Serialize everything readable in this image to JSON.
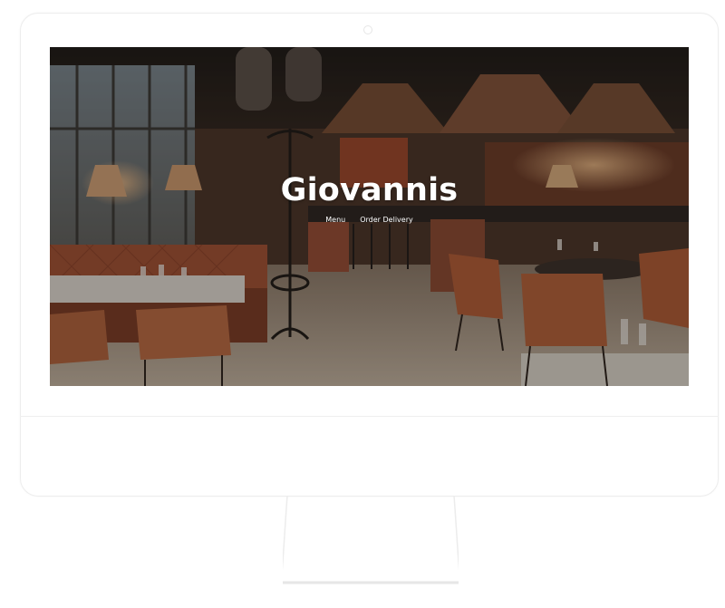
{
  "site": {
    "title": "Giovannis"
  },
  "nav": {
    "items": [
      {
        "label": "Menu"
      },
      {
        "label": "Order Delivery"
      }
    ]
  },
  "hero": {
    "image": "restaurant-interior-photo"
  }
}
